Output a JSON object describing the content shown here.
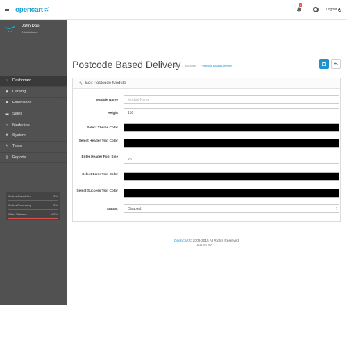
{
  "header": {
    "logo_text": "opencart",
    "logo_mark": "⁽ᐧᐧ",
    "bell_badge": "8",
    "logout_label": "Logout",
    "icons": [
      "hamburger-icon",
      "bell-icon",
      "lifebuoy-icon",
      "power-icon"
    ]
  },
  "sidebar": {
    "profile": {
      "name": "John Doe",
      "role": "Administrator"
    },
    "items": [
      {
        "label": "Dashboard",
        "icon": "⌂",
        "active": true,
        "arrow": ""
      },
      {
        "label": "Catalog",
        "icon": "◆",
        "active": false,
        "arrow": "›"
      },
      {
        "label": "Extensions",
        "icon": "✱",
        "active": false,
        "arrow": "›"
      },
      {
        "label": "Sales",
        "icon": "▬",
        "active": false,
        "arrow": "›"
      },
      {
        "label": "Marketing",
        "icon": "<",
        "active": false,
        "arrow": "›"
      },
      {
        "label": "System",
        "icon": "✺",
        "active": false,
        "arrow": "›"
      },
      {
        "label": "Tools",
        "icon": "✎",
        "active": false,
        "arrow": "›"
      },
      {
        "label": "Reports",
        "icon": "▥",
        "active": false,
        "arrow": "›"
      }
    ],
    "stats": [
      {
        "label": "Orders Completed",
        "value": "0%",
        "fraction": 0,
        "color": "#8fbb6c"
      },
      {
        "label": "Orders Processing",
        "value": "0%",
        "fraction": 0,
        "color": "#f0ad4e"
      },
      {
        "label": "Other Statuses",
        "value": "100%",
        "fraction": 1,
        "color": "#d9534f"
      }
    ]
  },
  "page": {
    "title": "Postcode Based Delivery",
    "breadcrumb": [
      "Home",
      "/",
      "Modules",
      "/",
      "Postcode Based Delivery"
    ],
    "save_icon": "save-icon",
    "back_icon": "reply-icon"
  },
  "panel": {
    "title": "Edit Postcode Module",
    "fields": [
      {
        "label": "Module Name",
        "value": "",
        "placeholder": "Module Name",
        "kind": "text"
      },
      {
        "label": "Height",
        "value": "150",
        "placeholder": "",
        "kind": "text"
      },
      {
        "label": "Select Theme Color",
        "value": "",
        "placeholder": "",
        "kind": "color",
        "color": "#000000"
      },
      {
        "label": "Select Header Text Color",
        "value": "",
        "placeholder": "",
        "kind": "color",
        "color": "#000000"
      },
      {
        "label": "Enter Header Font Size",
        "value": "20",
        "placeholder": "",
        "kind": "text"
      },
      {
        "label": "Select Error Text Color",
        "value": "",
        "placeholder": "",
        "kind": "color",
        "color": "#000000"
      },
      {
        "label": "Select Success Text Color",
        "value": "",
        "placeholder": "",
        "kind": "color",
        "color": "#000000"
      },
      {
        "label": "Status:",
        "value": "Disabled",
        "placeholder": "",
        "kind": "select"
      }
    ]
  },
  "footer": {
    "link": "OpenCart",
    "copyright": "© 2009-2015 All Rights Reserved.",
    "version": "Version 2.0.1.1"
  },
  "colors": {
    "accent": "#1e91cf",
    "sidebar_bg": "#515151"
  }
}
